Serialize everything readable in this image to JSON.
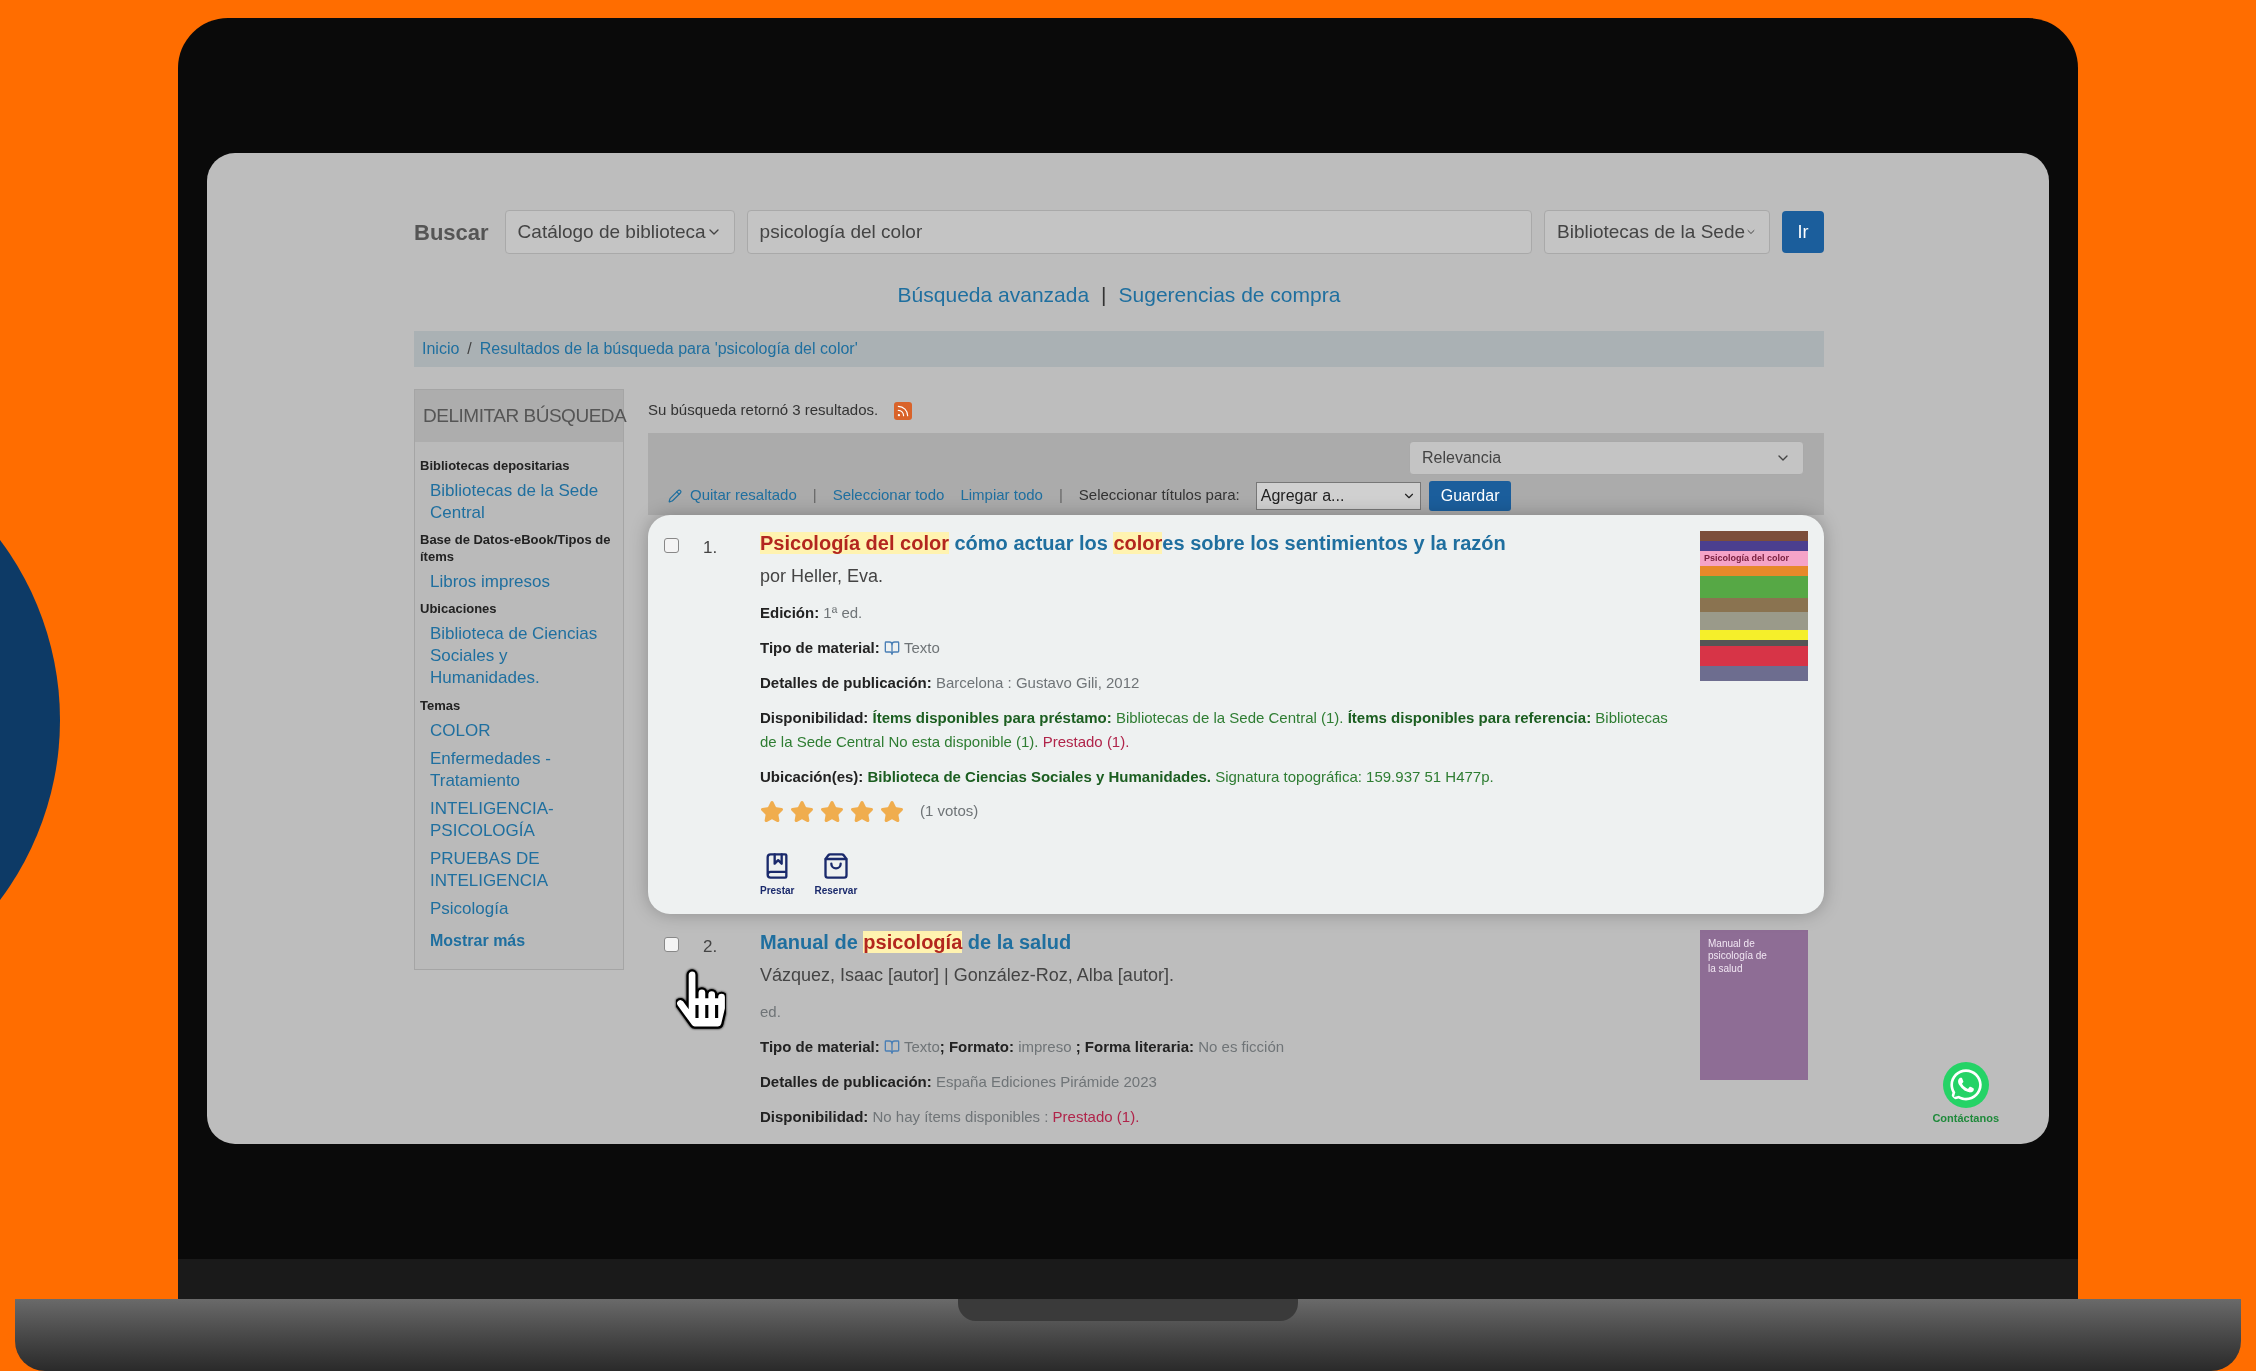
{
  "search": {
    "label": "Buscar",
    "catalog_select": "Catálogo de biblioteca",
    "query": "psicología del color",
    "library_select": "Bibliotecas de la Sede",
    "go_button": "Ir"
  },
  "links": {
    "items": [
      "Búsqueda avanzada",
      "Sugerencias de compra"
    ],
    "separator": "|"
  },
  "breadcrumb": {
    "items": [
      "Inicio",
      "Resultados de la búsqueda para 'psicología del color'"
    ],
    "separator": "/"
  },
  "sidebar": {
    "title": "DELIMITAR BÚSQUEDA",
    "groups": [
      {
        "heading": "Bibliotecas depositarias",
        "items": [
          "Bibliotecas de la Sede Central"
        ]
      },
      {
        "heading": "Base de Datos-eBook/Tipos de ítems",
        "items": [
          "Libros impresos"
        ]
      },
      {
        "heading": "Ubicaciones",
        "items": [
          "Biblioteca de Ciencias Sociales y Humanidades."
        ]
      },
      {
        "heading": "Temas",
        "items": [
          "COLOR",
          "Enfermedades - Tratamiento",
          "INTELIGENCIA-PSICOLOGÍA",
          "PRUEBAS DE INTELIGENCIA",
          "Psicología"
        ]
      }
    ],
    "more": "Mostrar más"
  },
  "summary": "Su búsqueda retornó 3 resultados.",
  "sort_select": "Relevancia",
  "toolbar": {
    "highlight_link": "Quitar resaltado",
    "separator": "|",
    "select_all": "Seleccionar todo",
    "clear_all": "Limpiar todo",
    "select_titles_label": "Seleccionar títulos para:",
    "add_to_select": "Agregar a...",
    "save_button": "Guardar"
  },
  "results": [
    {
      "focused": true,
      "checked": false,
      "number": "1.",
      "title": [
        {
          "text": "Psicología del color",
          "highlighted": true
        },
        {
          "text": " cómo actuar los ",
          "highlighted": false
        },
        {
          "text": "color",
          "highlighted": true
        },
        {
          "text": "es sobre los sentimientos y la razón",
          "highlighted": false
        }
      ],
      "author": "por Heller, Eva.",
      "fields": [
        {
          "kind": "plain",
          "label": "Edición:",
          "segments": [
            {
              "text": "1ª ed.",
              "kind": "plain"
            }
          ]
        },
        {
          "kind": "material",
          "label": "Tipo de material:",
          "segments": [
            {
              "text": "Texto",
              "kind": "plain"
            }
          ]
        },
        {
          "kind": "plain",
          "label": "Detalles de publicación:",
          "segments": [
            {
              "text": "Barcelona : Gustavo Gili, 2012",
              "kind": "plain"
            }
          ]
        },
        {
          "kind": "plain",
          "label": "Disponibilidad:",
          "segments": [
            {
              "text": "Ítems disponibles para préstamo:",
              "kind": "green-bold"
            },
            {
              "text": " Bibliotecas de la Sede Central (1). ",
              "kind": "green"
            },
            {
              "text": "Ítems disponibles para referencia:",
              "kind": "green-bold"
            },
            {
              "text": " Bibliotecas de la Sede Central No esta disponible (1). ",
              "kind": "green"
            },
            {
              "text": "Prestado (1).",
              "kind": "red"
            }
          ]
        },
        {
          "kind": "plain",
          "label": "Ubicación(es):",
          "segments": [
            {
              "text": "Biblioteca de Ciencias Sociales y Humanidades.",
              "kind": "green-bold"
            },
            {
              "text": " Signatura topográfica: 159.937 51 H477p.",
              "kind": "green"
            }
          ]
        }
      ],
      "stars": 5,
      "votes": "(1 votos)",
      "actions": [
        "Prestar",
        "Reservar"
      ],
      "cover": {
        "title": "Psicología del color"
      }
    },
    {
      "focused": false,
      "checked": false,
      "number": "2.",
      "title": [
        {
          "text": "Manual de ",
          "highlighted": false
        },
        {
          "text": "psicología",
          "highlighted": true
        },
        {
          "text": " de la salud",
          "highlighted": false
        }
      ],
      "author": "Vázquez, Isaac [autor] | González-Roz, Alba [autor].",
      "fields": [
        {
          "kind": "plain",
          "segments": [
            {
              "text": "ed.",
              "kind": "plain"
            }
          ]
        },
        {
          "kind": "material",
          "label": "Tipo de material:",
          "segments": [
            {
              "text": "Texto",
              "kind": "plain"
            },
            {
              "text": "; Formato:",
              "kind": "label"
            },
            {
              "text": " impreso ",
              "kind": "plain"
            },
            {
              "text": "; Forma literaria:",
              "kind": "label"
            },
            {
              "text": " No es ficción",
              "kind": "plain"
            }
          ]
        },
        {
          "kind": "plain",
          "label": "Detalles de publicación:",
          "segments": [
            {
              "text": "España Ediciones Pirámide 2023",
              "kind": "plain"
            }
          ]
        },
        {
          "kind": "plain",
          "label": "Disponibilidad:",
          "segments": [
            {
              "text": "No hay ítems disponibles : ",
              "kind": "plain"
            },
            {
              "text": "Prestado (1).",
              "kind": "red"
            }
          ]
        }
      ],
      "cover": {
        "title": "Manual de psicología de la salud"
      }
    }
  ],
  "chat_widget": {
    "label": "Contáctanos"
  }
}
